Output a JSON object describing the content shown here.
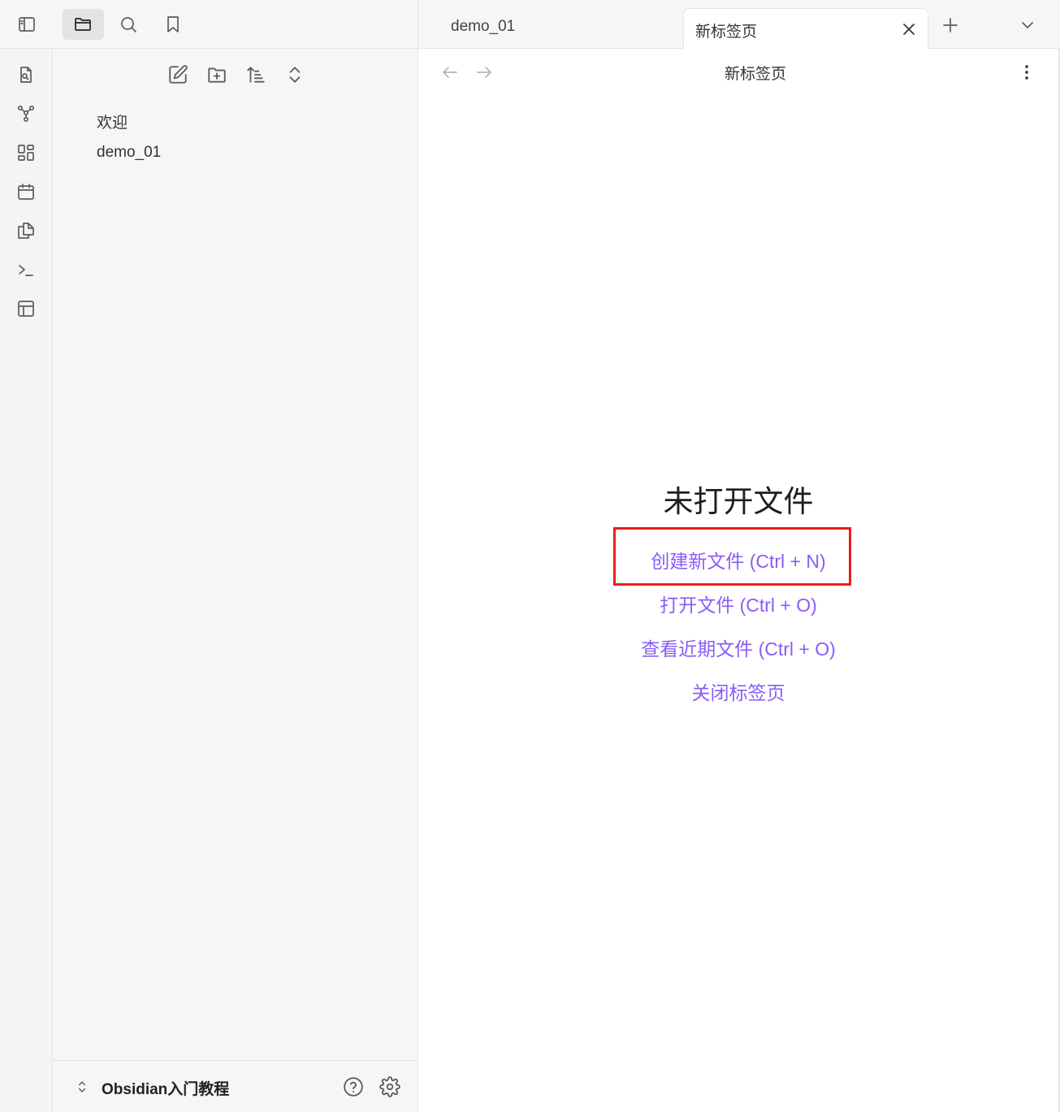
{
  "tabs": {
    "inactive_label": "demo_01",
    "active_label": "新标签页"
  },
  "explorer": {
    "files": [
      "欢迎",
      "demo_01"
    ],
    "vault_name": "Obsidian入门教程"
  },
  "view": {
    "title": "新标签页",
    "empty_title": "未打开文件",
    "actions": [
      "创建新文件 (Ctrl + N)",
      "打开文件 (Ctrl + O)",
      "查看近期文件 (Ctrl + O)",
      "关闭标签页"
    ]
  },
  "colors": {
    "accent": "#8a5cf5",
    "highlight_box": "#ee1c1c"
  }
}
